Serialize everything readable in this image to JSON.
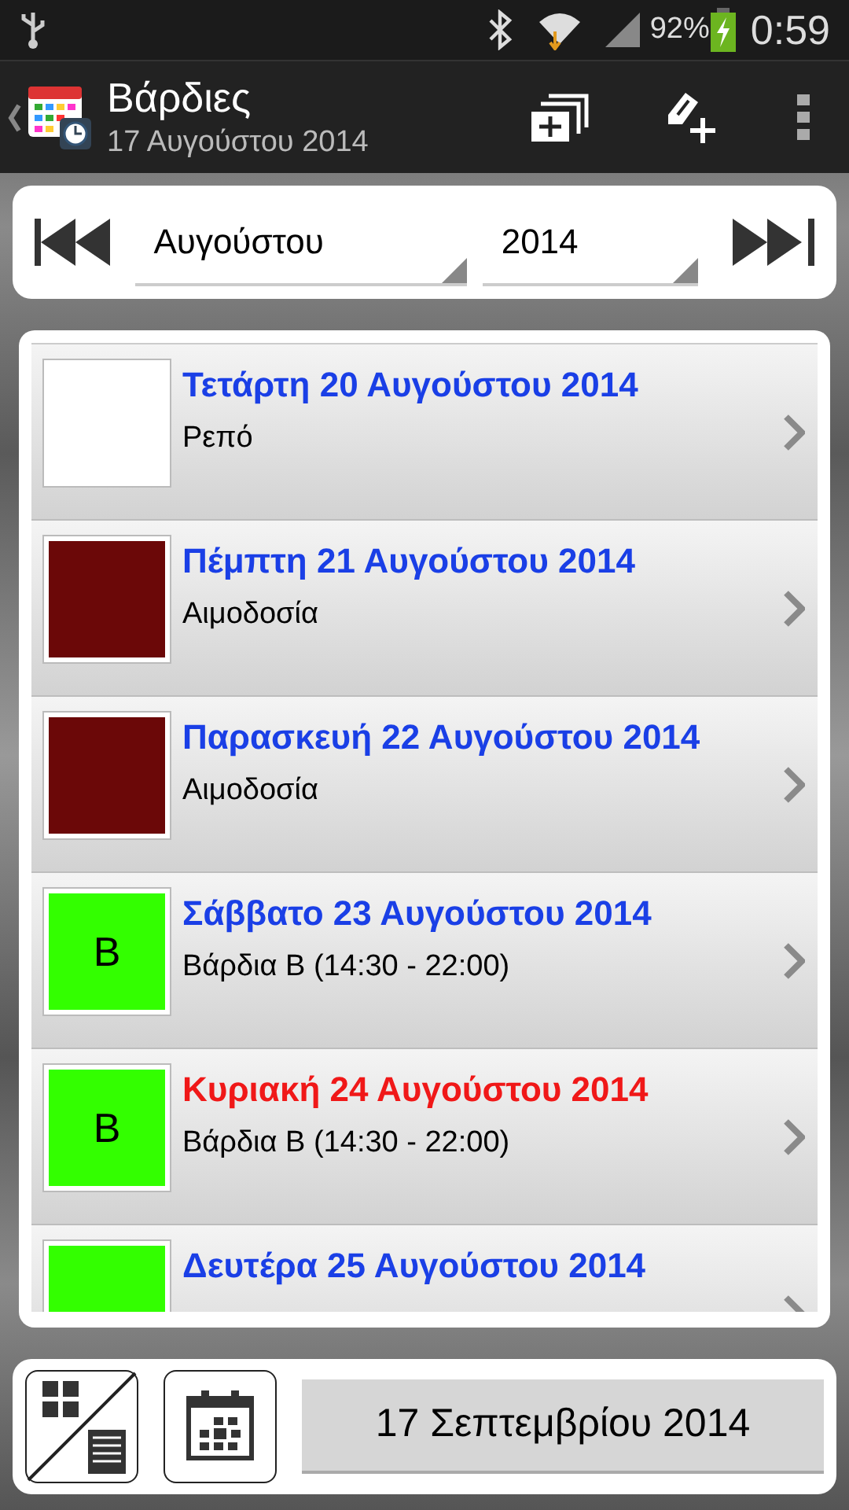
{
  "status_bar": {
    "battery": "92%",
    "time": "0:59"
  },
  "action_bar": {
    "title": "Βάρδιες",
    "subtitle": "17 Αυγούστου 2014"
  },
  "navigator": {
    "month": "Αυγούστου",
    "year": "2014"
  },
  "days": [
    {
      "title": "Τετάρτη 20 Αυγούστου 2014",
      "subtitle": "Ρεπό",
      "color": "#ffffff",
      "highlighted": false
    },
    {
      "title": "Πέμπτη 21 Αυγούστου 2014",
      "subtitle": "Αιμοδοσία",
      "color": "#6b0808",
      "highlighted": false
    },
    {
      "title": "Παρασκευή 22 Αυγούστου 2014",
      "subtitle": "Αιμοδοσία",
      "color": "#6b0808",
      "highlighted": false
    },
    {
      "title": "Σάββατο 23 Αυγούστου 2014",
      "subtitle": "Βάρδια Β (14:30 - 22:00)",
      "letter": "Β",
      "color": "#33ff00",
      "highlighted": false
    },
    {
      "title": "Κυριακή 24 Αυγούστου 2014",
      "subtitle": "Βάρδια Β (14:30 - 22:00)",
      "letter": "Β",
      "color": "#33ff00",
      "highlighted": true
    },
    {
      "title": "Δευτέρα 25 Αυγούστου 2014",
      "color": "#33ff00",
      "highlighted": false
    }
  ],
  "bottom_bar": {
    "date_button": "17 Σεπτεμβρίου 2014"
  }
}
